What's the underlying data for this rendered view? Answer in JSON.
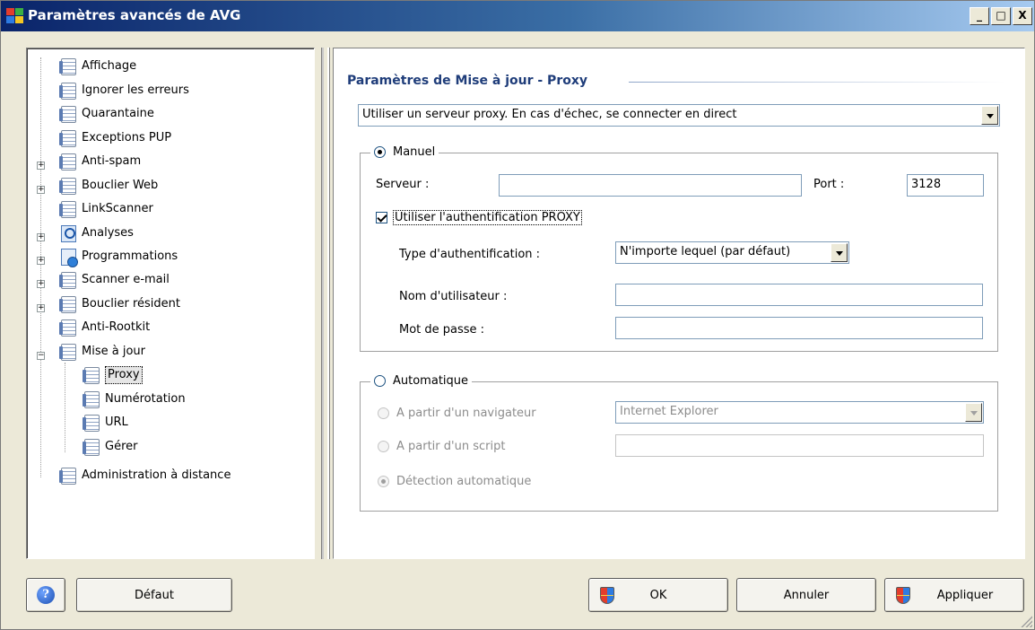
{
  "window": {
    "title": "Paramètres avancés de AVG",
    "minimize": "_",
    "maximize": "□",
    "close": "X"
  },
  "tree": [
    {
      "label": "Affichage"
    },
    {
      "label": "Ignorer les erreurs"
    },
    {
      "label": "Quarantaine"
    },
    {
      "label": "Exceptions PUP"
    },
    {
      "label": "Anti-spam"
    },
    {
      "label": "Bouclier Web"
    },
    {
      "label": "LinkScanner"
    },
    {
      "label": "Analyses"
    },
    {
      "label": "Programmations"
    },
    {
      "label": "Scanner e-mail"
    },
    {
      "label": "Bouclier résident"
    },
    {
      "label": "Anti-Rootkit"
    },
    {
      "label": "Mise à jour"
    },
    {
      "label": "Proxy"
    },
    {
      "label": "Numérotation"
    },
    {
      "label": "URL"
    },
    {
      "label": "Gérer"
    },
    {
      "label": "Administration à distance"
    }
  ],
  "main": {
    "section_title": "Paramètres de Mise à jour - Proxy",
    "proxy_mode": "Utiliser un serveur proxy. En cas d'échec, se connecter en direct",
    "manual": {
      "legend": "Manuel",
      "server_label": "Serveur :",
      "server_value": "",
      "port_label": "Port :",
      "port_value": "3128",
      "auth_checkbox": "Utiliser l'authentification PROXY",
      "auth_type_label": "Type d'authentification :",
      "auth_type_value": "N'importe lequel (par défaut)",
      "username_label": "Nom d'utilisateur :",
      "username_value": "",
      "password_label": "Mot de passe :",
      "password_value": ""
    },
    "automatic": {
      "legend": "Automatique",
      "from_browser": "A partir d'un navigateur",
      "browser_value": "Internet Explorer",
      "from_script": "A partir d'un script",
      "script_value": "",
      "auto_detect": "Détection automatique"
    }
  },
  "footer": {
    "help": "?",
    "default": "Défaut",
    "ok": "OK",
    "cancel": "Annuler",
    "apply": "Appliquer"
  },
  "colors": {
    "title_blue": "#1f3d7a",
    "titlebar_start": "#0a246a",
    "window_bg": "#ece9d8"
  }
}
